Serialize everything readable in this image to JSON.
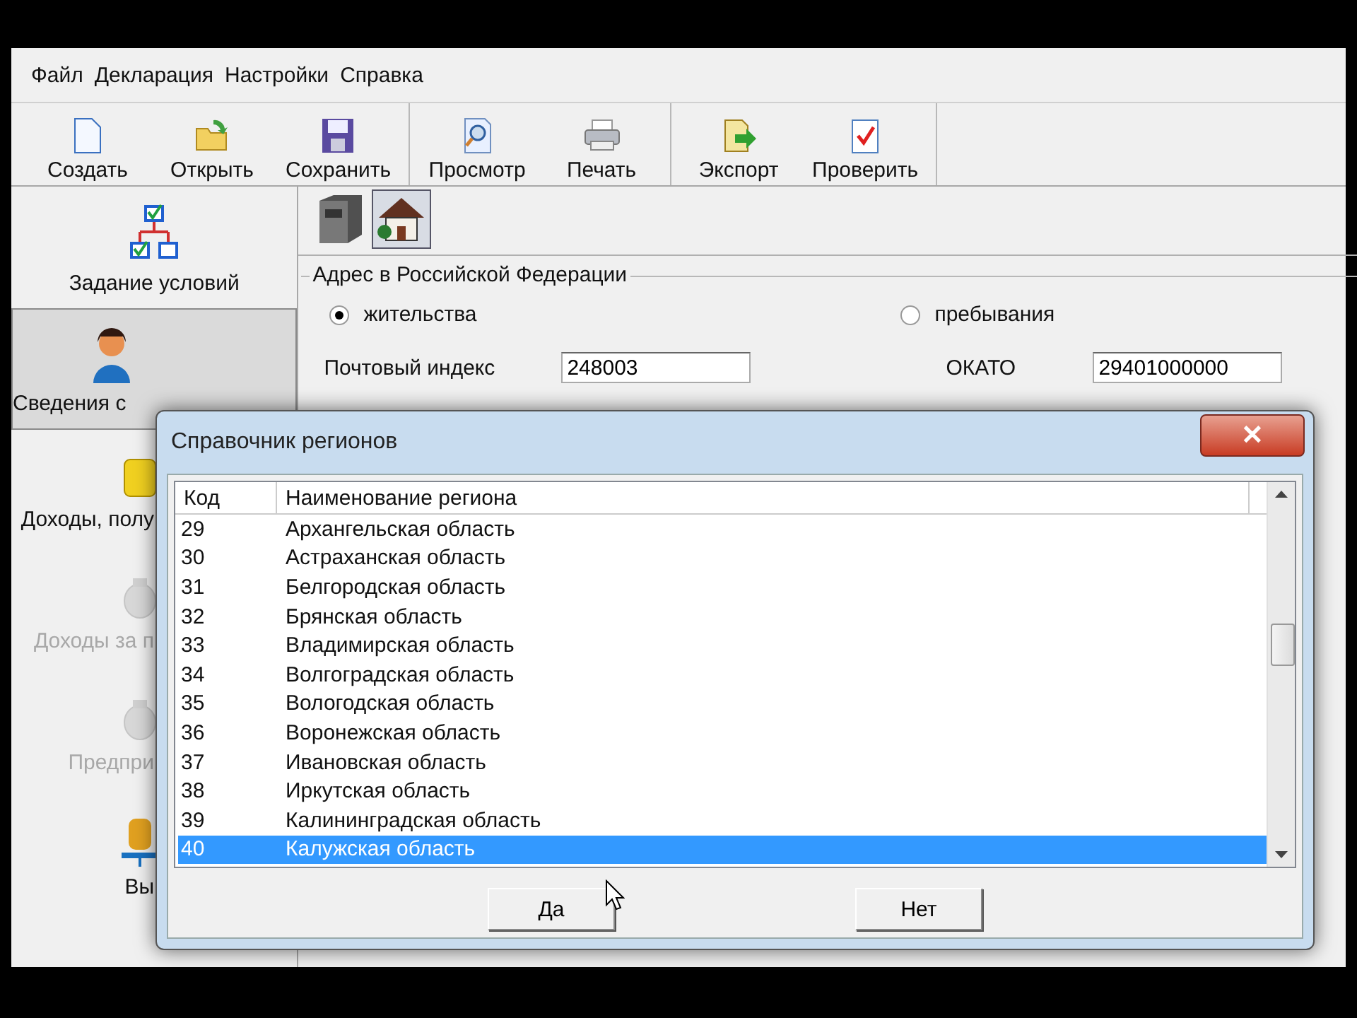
{
  "menu": [
    "Файл",
    "Декларация",
    "Настройки",
    "Справка"
  ],
  "toolbar": [
    [
      {
        "label": "Создать"
      },
      {
        "label": "Открыть"
      },
      {
        "label": "Сохранить"
      }
    ],
    [
      {
        "label": "Просмотр"
      },
      {
        "label": "Печать"
      }
    ],
    [
      {
        "label": "Экспорт"
      },
      {
        "label": "Проверить"
      }
    ]
  ],
  "sidebar": {
    "items": [
      {
        "label": "Задание условий",
        "selected": false,
        "disabled": false
      },
      {
        "label": "Сведения с",
        "selected": true,
        "disabled": false
      },
      {
        "label": "Доходы, полу",
        "selected": false,
        "disabled": false
      },
      {
        "label": "Доходы за п",
        "selected": false,
        "disabled": true
      },
      {
        "label": "Предпри",
        "selected": false,
        "disabled": true
      },
      {
        "label": "Вы",
        "selected": false,
        "disabled": false
      }
    ]
  },
  "address_tabs": [
    {
      "selected": false
    },
    {
      "selected": true
    }
  ],
  "address": {
    "title": "Адрес в Российской Федерации",
    "radios": [
      {
        "label": "жительства",
        "selected": true
      },
      {
        "label": "пребывания",
        "selected": false
      }
    ],
    "postal_label": "Почтовый индекс",
    "postal_value": "248003",
    "okato_label": "ОКАТО",
    "okato_value": "29401000000"
  },
  "dialog": {
    "title": "Справочник регионов",
    "close": "✕",
    "columns": [
      "Код",
      "Наименование региона"
    ],
    "rows": [
      {
        "code": "29",
        "name": "Архангельская область",
        "selected": false
      },
      {
        "code": "30",
        "name": "Астраханская область",
        "selected": false
      },
      {
        "code": "31",
        "name": "Белгородская область",
        "selected": false
      },
      {
        "code": "32",
        "name": "Брянская область",
        "selected": false
      },
      {
        "code": "33",
        "name": "Владимирская область",
        "selected": false
      },
      {
        "code": "34",
        "name": "Волгоградская область",
        "selected": false
      },
      {
        "code": "35",
        "name": "Вологодская область",
        "selected": false
      },
      {
        "code": "36",
        "name": "Воронежская область",
        "selected": false
      },
      {
        "code": "37",
        "name": "Ивановская область",
        "selected": false
      },
      {
        "code": "38",
        "name": "Иркутская область",
        "selected": false
      },
      {
        "code": "39",
        "name": "Калининградская область",
        "selected": false
      },
      {
        "code": "40",
        "name": "Калужская область",
        "selected": true
      }
    ],
    "buttons": [
      "Да",
      "Нет"
    ]
  }
}
